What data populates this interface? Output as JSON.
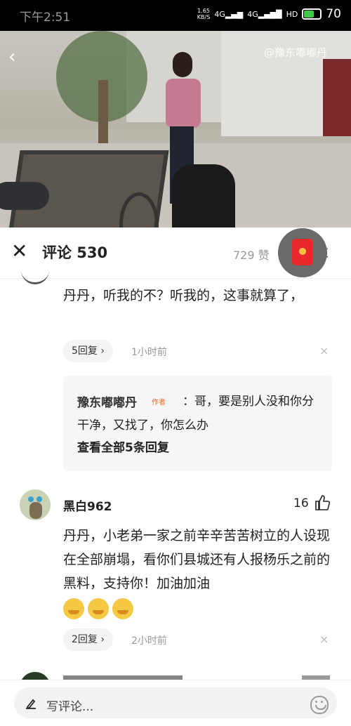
{
  "status_bar": {
    "time": "下午2:51",
    "speed_value": "1.65",
    "speed_unit": "KB/S",
    "net1": "4G",
    "net2": "4G",
    "hd": "HD",
    "battery": "70",
    "battery_level_percent": 70,
    "battery_color": "#3ec94a"
  },
  "video": {
    "watermark": "@豫东嘟嘟丹",
    "back_icon": "back-arrow-icon",
    "progress_fraction": 0.02
  },
  "comments_header": {
    "title": "评论 530",
    "likes": "729 赞",
    "send_partial": "发",
    "close_icon": "close-icon",
    "redpacket_icon": "red-envelope-icon"
  },
  "comments": [
    {
      "text": "丹丹，听我的不？听我的，这事就算了，",
      "reply_count": "5回复 ›",
      "time": "1小时前",
      "dismiss": "×",
      "reply": {
        "author": "豫东嘟嘟丹",
        "author_tag": "作者",
        "text": "：哥，要是别人没和你分干净，又找了，你怎么办",
        "view_all": "查看全部5条回复"
      }
    },
    {
      "user": "黑白962",
      "likes": "16",
      "text": "丹丹，小老弟一家之前辛辛苦苦树立的人设现在全部崩塌，看你们县城还有人报杨乐之前的黑料，支持你！加油加油",
      "emojis": [
        "smiling-face-icon",
        "smiling-face-icon",
        "smiling-face-icon"
      ],
      "reply_count": "2回复 ›",
      "time": "2小时前",
      "dismiss": "×"
    }
  ],
  "input_bar": {
    "placeholder": "写评论...",
    "pen_icon": "pen-icon",
    "emoji_icon": "smile-icon"
  },
  "colors": {
    "accent_red": "#e8282b",
    "author_tag": "#e96a2e",
    "muted": "#999999"
  }
}
